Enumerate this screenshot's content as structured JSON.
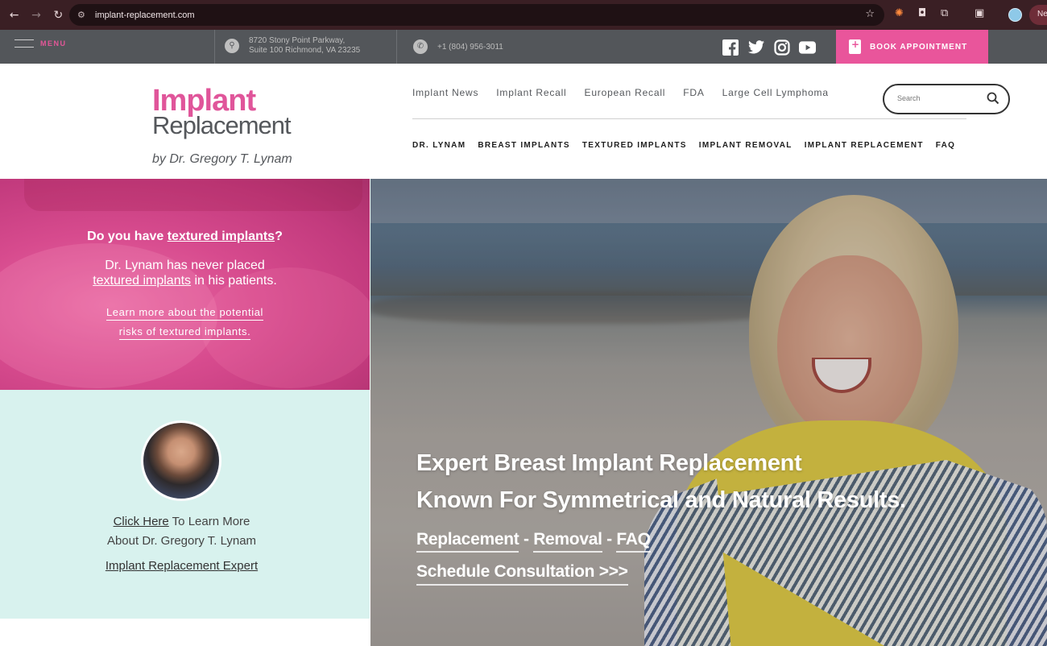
{
  "browser": {
    "url": "implant-replacement.com",
    "new_chip": "Ne"
  },
  "topbar": {
    "menu_label": "MENU",
    "address_line1": "8720 Stony Point Parkway,",
    "address_line2": "Suite 100 Richmond, VA 23235",
    "phone": "+1 (804) 956-3011",
    "book_label": "BOOK APPOINTMENT",
    "socials": [
      "facebook-icon",
      "twitter-icon",
      "instagram-icon",
      "youtube-icon"
    ]
  },
  "header": {
    "logo_line1": "Implant",
    "logo_line2": "Replacement",
    "logo_by": "by Dr. Gregory T. Lynam",
    "top_nav": [
      "Implant News",
      "Implant Recall",
      "European Recall",
      "FDA",
      "Large Cell Lymphoma"
    ],
    "search_placeholder": "Search",
    "main_nav": [
      "DR. LYNAM",
      "BREAST IMPLANTS",
      "TEXTURED IMPLANTS",
      "IMPLANT REMOVAL",
      "IMPLANT REPLACEMENT",
      "FAQ"
    ]
  },
  "pink_panel": {
    "q_prefix": "Do you have ",
    "q_link": "textured implants",
    "q_suffix": "?",
    "t_line1": "Dr. Lynam has never placed",
    "t_link": "textured implants",
    "t_suffix": " in his patients.",
    "learn_line1": "Learn more about the potential",
    "learn_line2": "risks of textured implants."
  },
  "mint_panel": {
    "click_here": "Click Here",
    "click_suffix": " To Learn More",
    "line2": "About Dr. Gregory T. Lynam",
    "expert_link": "Implant Replacement Expert"
  },
  "hero": {
    "headline1": "Expert Breast Implant Replacement",
    "headline2": "Known For Symmetrical and Natural Results.",
    "link_replacement": "Replacement",
    "sep1": " - ",
    "link_removal": "Removal",
    "sep2": " - ",
    "link_faq": "FAQ",
    "cta": "Schedule Consultation >>>"
  },
  "colors": {
    "brand_pink": "#e9559b",
    "topbar_gray": "#53565a",
    "mint": "#d8f2ee"
  }
}
